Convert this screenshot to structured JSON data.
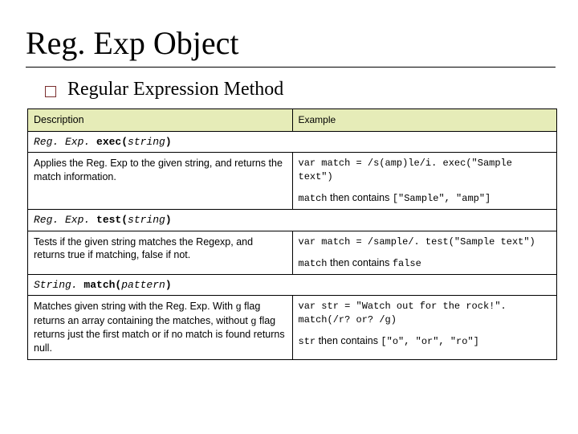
{
  "title": "Reg. Exp Object",
  "subtitle": "Regular Expression Method",
  "table": {
    "headers": {
      "desc": "Description",
      "example": "Example"
    },
    "rows": [
      {
        "sig_obj": "Reg. Exp.",
        "sig_method": " exec(",
        "sig_arg": "string",
        "sig_close": ")",
        "desc": "Applies the Reg. Exp to the given string, and returns the match information.",
        "ex_line1": "var match = /s(amp)le/i. exec(\"Sample text\")",
        "ex_line2_pre": "match",
        "ex_line2_mid": " then contains ",
        "ex_line2_post": "[\"Sample\", \"amp\"]"
      },
      {
        "sig_obj": "Reg. Exp.",
        "sig_method": " test(",
        "sig_arg": "string",
        "sig_close": ")",
        "desc": "Tests if the given string matches the Regexp, and returns true if matching, false if not.",
        "ex_line1": "var match = /sample/. test(\"Sample text\")",
        "ex_line2_pre": "match",
        "ex_line2_mid": " then contains ",
        "ex_line2_post": "false"
      },
      {
        "sig_obj": "String.",
        "sig_method": " match(",
        "sig_arg": "pattern",
        "sig_close": ")",
        "desc_pre": "Matches given string with the Reg. Exp. With ",
        "desc_g1": "g",
        "desc_mid1": " flag returns an array containing the matches, without ",
        "desc_g2": "g",
        "desc_mid2": " flag returns just the first match or if no match is found returns null.",
        "ex_line1": "var str = \"Watch out for the rock!\". match(/r? or? /g)",
        "ex_line2_pre": "str",
        "ex_line2_mid": " then contains ",
        "ex_line2_post": "[\"o\", \"or\", \"ro\"]"
      }
    ]
  }
}
